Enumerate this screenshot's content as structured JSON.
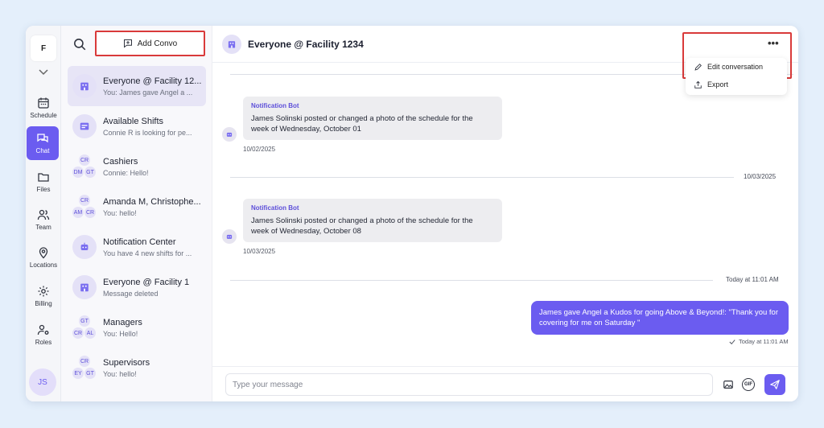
{
  "rail": {
    "logo": "F",
    "items": [
      {
        "label": "Schedule",
        "icon": "calendar-icon"
      },
      {
        "label": "Chat",
        "icon": "chat-icon"
      },
      {
        "label": "Files",
        "icon": "folder-icon"
      },
      {
        "label": "Team",
        "icon": "team-icon"
      },
      {
        "label": "Locations",
        "icon": "location-pin-icon"
      },
      {
        "label": "Billing",
        "icon": "gear-icon"
      },
      {
        "label": "Roles",
        "icon": "roles-icon"
      }
    ],
    "user_initials": "JS"
  },
  "convlist": {
    "add_label": "Add Convo",
    "items": [
      {
        "name": "Everyone @ Facility 12...",
        "preview": "You: James gave Angel a ..."
      },
      {
        "name": "Available Shifts",
        "preview": "Connie R is looking for pe..."
      },
      {
        "name": "Cashiers",
        "preview": "Connie: Hello!",
        "initials": [
          "CR",
          "DM",
          "GT"
        ]
      },
      {
        "name": "Amanda M, Christophe...",
        "preview": "You: hello!",
        "initials": [
          "CR",
          "AM",
          "CR"
        ]
      },
      {
        "name": "Notification Center",
        "preview": "You have 4 new shifts for ..."
      },
      {
        "name": "Everyone @ Facility 1",
        "preview": "Message deleted"
      },
      {
        "name": "Managers",
        "preview": "You: Hello!",
        "initials": [
          "GT",
          "CR",
          "AL"
        ]
      },
      {
        "name": "Supervisors",
        "preview": "You: hello!",
        "initials": [
          "CR",
          "EY",
          "GT"
        ]
      }
    ]
  },
  "chat": {
    "title": "Everyone @ Facility 1234",
    "more_label": "•••",
    "menu": [
      {
        "label": "Edit conversation",
        "icon": "pencil-icon"
      },
      {
        "label": "Export",
        "icon": "export-icon"
      }
    ],
    "messages": [
      {
        "sender": "Notification Bot",
        "text": "James Solinski posted or changed a photo of the schedule for the week of Wednesday, October 01",
        "time": "10/02/2025"
      },
      {
        "sender": "Notification Bot",
        "text": "James Solinski posted or changed a photo of the schedule for the week of Wednesday, October 08",
        "time": "10/03/2025"
      }
    ],
    "date_dividers": [
      "10/03/2025",
      "Today at 11:01 AM"
    ],
    "outgoing": {
      "text": "James gave Angel a Kudos for going Above & Beyond!: \"Thank you for covering for me on Saturday \"",
      "time": "Today at 11:01 AM"
    },
    "composer_placeholder": "Type your message",
    "composer_gif": "GIF"
  },
  "colors": {
    "accent": "#6b5cf0",
    "highlight": "#d93a3a"
  }
}
